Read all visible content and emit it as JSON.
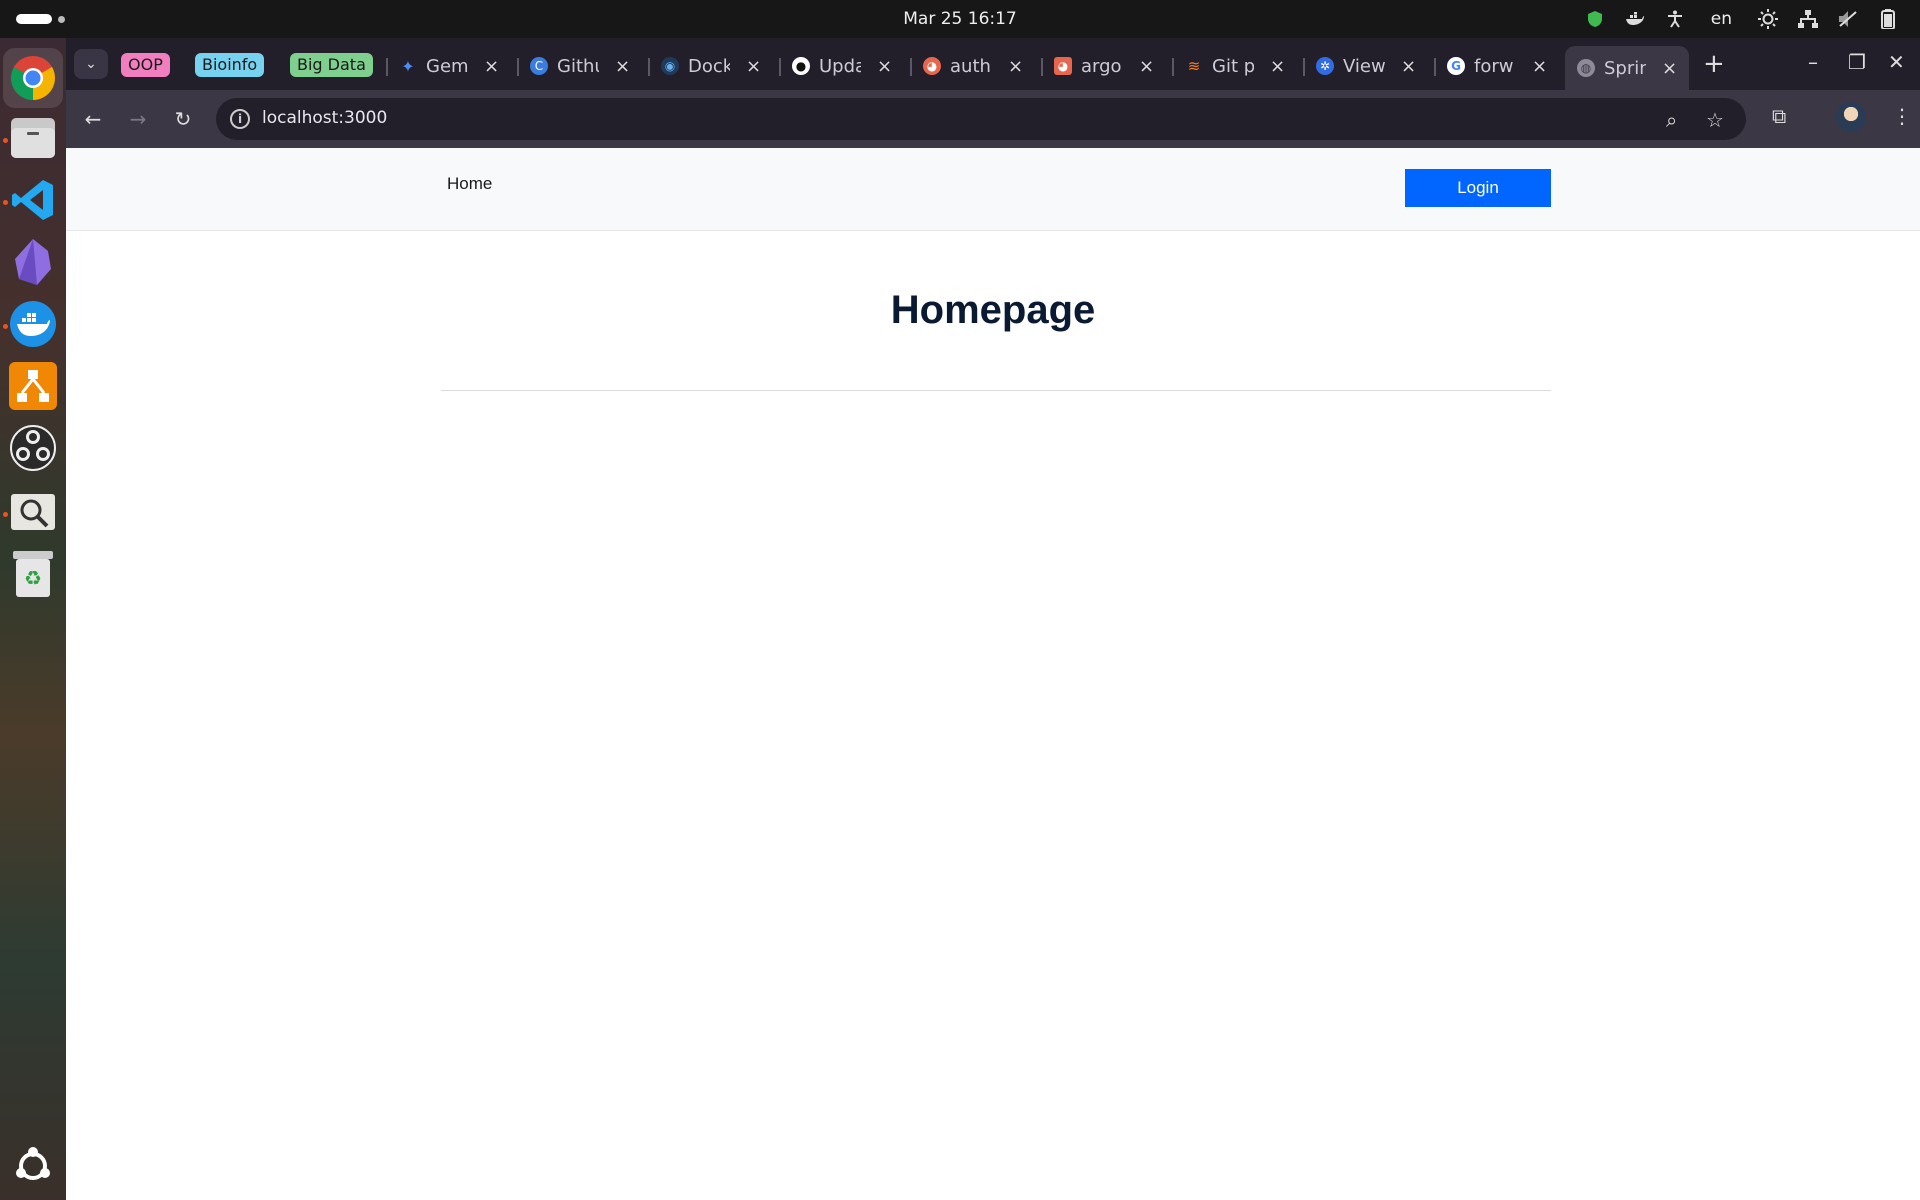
{
  "system": {
    "clock": "Mar 25  16:17",
    "language": "en"
  },
  "dock": {
    "apps": [
      "chrome-icon",
      "files-icon",
      "vscode-icon",
      "obsidian-icon",
      "docker-icon",
      "drawio-icon",
      "obs-icon",
      "image-viewer-icon",
      "trash-icon",
      "show-apps-icon"
    ]
  },
  "browser": {
    "tab_groups": [
      {
        "label": "OOP",
        "color": "#f17ebf"
      },
      {
        "label": "Bioinfo",
        "color": "#76d2ef"
      },
      {
        "label": "Big Data",
        "color": "#7fcf8e"
      }
    ],
    "tabs": [
      {
        "title": "Gemi"
      },
      {
        "title": "Githu"
      },
      {
        "title": "Dock"
      },
      {
        "title": "Upda"
      },
      {
        "title": "auth"
      },
      {
        "title": "argo"
      },
      {
        "title": "Git p"
      },
      {
        "title": "View"
      },
      {
        "title": "forw"
      },
      {
        "title": "Sprin"
      }
    ],
    "url": "localhost:3000"
  },
  "page": {
    "nav_home": "Home",
    "login_label": "Login",
    "title": "Homepage"
  }
}
